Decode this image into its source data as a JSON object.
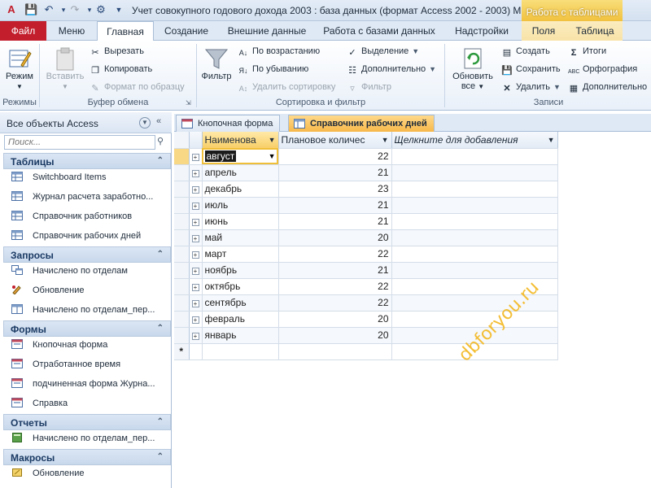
{
  "window": {
    "title": "Учет совокупного годового дохода 2003 : база данных (формат Access 2002 - 2003) М.",
    "context_tools": "Работа с таблицами"
  },
  "tabs": [
    "Файл",
    "Меню",
    "Главная",
    "Создание",
    "Внешние данные",
    "Работа с базами данных",
    "Надстройки",
    "Поля",
    "Таблица"
  ],
  "ribbon": {
    "views": {
      "view": "Режим",
      "group": "Режимы"
    },
    "clipboard": {
      "paste": "Вставить",
      "cut": "Вырезать",
      "copy": "Копировать",
      "format_painter": "Формат по образцу",
      "group": "Буфер обмена"
    },
    "sort_filter": {
      "filter": "Фильтр",
      "ascending": "По возрастанию",
      "descending": "По убыванию",
      "remove_sort": "Удалить сортировку",
      "selection": "Выделение",
      "advanced": "Дополнительно",
      "toggle_filter": "Фильтр",
      "group": "Сортировка и фильтр"
    },
    "records": {
      "refresh_line1": "Обновить",
      "refresh_line2": "все",
      "new": "Создать",
      "save": "Сохранить",
      "delete": "Удалить",
      "totals": "Итоги",
      "spelling": "Орфография",
      "more": "Дополнительно",
      "group": "Записи"
    }
  },
  "nav": {
    "title": "Все объекты Access",
    "search_placeholder": "Поиск...",
    "categories": [
      {
        "name": "Таблицы",
        "items": [
          "Switchboard Items",
          "Журнал расчета заработно...",
          "Справочник работников",
          "Справочник рабочих дней"
        ]
      },
      {
        "name": "Запросы",
        "items": [
          "Начислено по отделам",
          "Обновление",
          "Начислено по отделам_пер..."
        ]
      },
      {
        "name": "Формы",
        "items": [
          "Кнопочная форма",
          "Отработанное время",
          "подчиненная форма Журна...",
          "Справка"
        ]
      },
      {
        "name": "Отчеты",
        "items": [
          "Начислено по отделам_пер..."
        ]
      },
      {
        "name": "Макросы",
        "items": [
          "Обновление"
        ]
      }
    ]
  },
  "doc_tabs": [
    "Кнопочная форма",
    "Справочник рабочих дней"
  ],
  "grid": {
    "columns": [
      "Наименова",
      "Плановое количес",
      "Щелкните для добавления"
    ],
    "rows": [
      {
        "name": "август",
        "days": "22"
      },
      {
        "name": "апрель",
        "days": "21"
      },
      {
        "name": "декабрь",
        "days": "23"
      },
      {
        "name": "июль",
        "days": "21"
      },
      {
        "name": "июнь",
        "days": "21"
      },
      {
        "name": "май",
        "days": "20"
      },
      {
        "name": "март",
        "days": "22"
      },
      {
        "name": "ноябрь",
        "days": "21"
      },
      {
        "name": "октябрь",
        "days": "22"
      },
      {
        "name": "сентябрь",
        "days": "22"
      },
      {
        "name": "февраль",
        "days": "20"
      },
      {
        "name": "январь",
        "days": "20"
      }
    ],
    "new_row_marker": "*"
  },
  "watermark": "dbforyou.ru",
  "colors": {
    "accent": "#f7b84a",
    "file_tab": "#c21e2c",
    "nav_header": "#1b3a63"
  }
}
